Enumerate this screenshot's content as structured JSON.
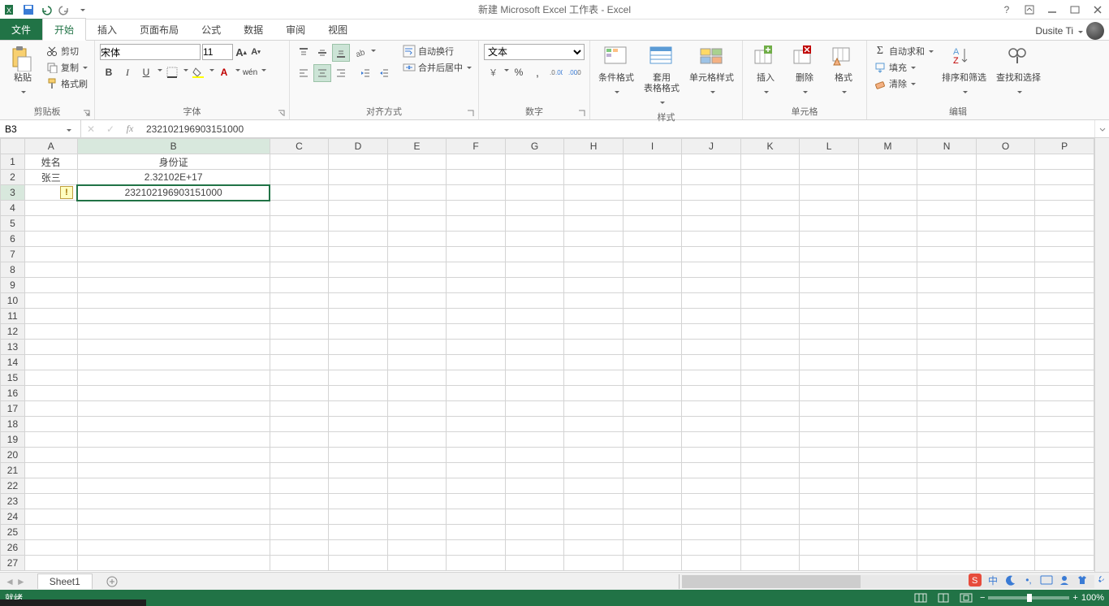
{
  "window": {
    "title": "新建 Microsoft Excel 工作表 - Excel"
  },
  "user": {
    "name": "Dusite Ti"
  },
  "tabs": {
    "file": "文件",
    "home": "开始",
    "insert": "插入",
    "layout": "页面布局",
    "formulas": "公式",
    "data": "数据",
    "review": "审阅",
    "view": "视图"
  },
  "ribbon": {
    "clipboard": {
      "label": "剪贴板",
      "paste": "粘贴",
      "cut": "剪切",
      "copy": "复制",
      "painter": "格式刷"
    },
    "font": {
      "label": "字体",
      "name": "宋体",
      "size": "11"
    },
    "align": {
      "label": "对齐方式",
      "wrap": "自动换行",
      "merge": "合并后居中"
    },
    "number": {
      "label": "数字",
      "format": "文本"
    },
    "styles": {
      "label": "样式",
      "cond": "条件格式",
      "table": "套用\n表格格式",
      "cell": "单元格样式"
    },
    "cells": {
      "label": "单元格",
      "insert": "插入",
      "delete": "删除",
      "format": "格式"
    },
    "editing": {
      "label": "编辑",
      "sum": "自动求和",
      "fill": "填充",
      "clear": "清除",
      "sort": "排序和筛选",
      "find": "查找和选择"
    }
  },
  "namebox": "B3",
  "formula": "232102196903151000",
  "columns": [
    "A",
    "B",
    "C",
    "D",
    "E",
    "F",
    "G",
    "H",
    "I",
    "J",
    "K",
    "L",
    "M",
    "N",
    "O",
    "P"
  ],
  "rows": 27,
  "cells": {
    "A1": "姓名",
    "B1": "身份证",
    "A2": "张三",
    "B2": "2.32102E+17",
    "B3": "232102196903151000"
  },
  "activeCell": {
    "col": "B",
    "row": 3
  },
  "sheets": {
    "active": "Sheet1"
  },
  "status": {
    "ready": "就绪",
    "zoom": "100%"
  }
}
